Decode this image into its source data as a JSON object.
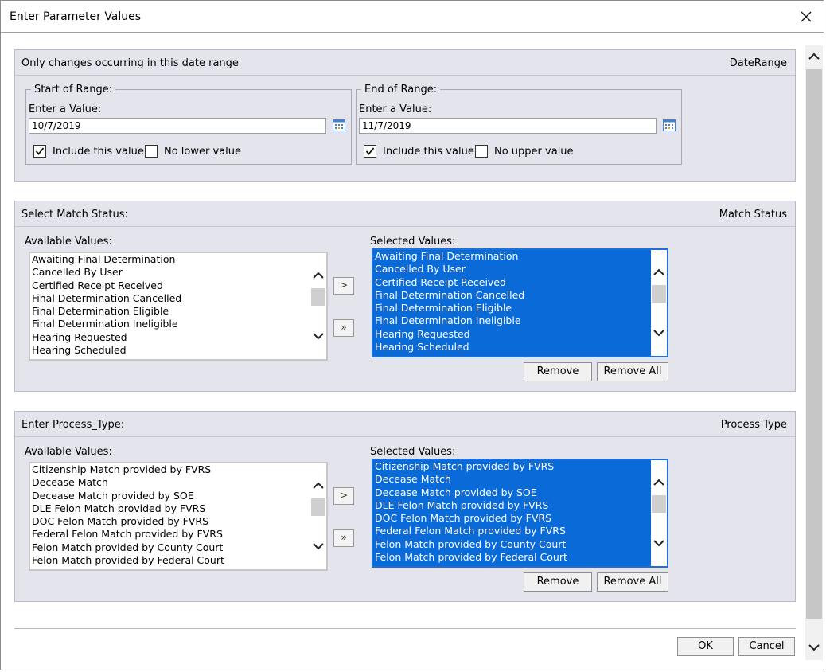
{
  "dialog": {
    "title": "Enter Parameter Values"
  },
  "date_range": {
    "prompt": "Only changes occurring in this date range",
    "name": "DateRange",
    "start": {
      "legend": "Start of Range:",
      "label": "Enter a Value:",
      "value": "10/7/2019",
      "include_label": "Include this value",
      "include_checked": true,
      "limit_label": "No lower value",
      "limit_checked": false
    },
    "end": {
      "legend": "End of Range:",
      "label": "Enter a Value:",
      "value": "11/7/2019",
      "include_label": "Include this value",
      "include_checked": true,
      "limit_label": "No upper value",
      "limit_checked": false
    }
  },
  "match_status": {
    "prompt": "Select Match Status:",
    "name": "Match Status",
    "available_label": "Available Values:",
    "selected_label": "Selected Values:",
    "available": [
      "Awaiting Final Determination",
      "Cancelled By User",
      "Certified Receipt Received",
      "Final Determination Cancelled",
      "Final Determination Eligible",
      "Final Determination Ineligible",
      "Hearing Requested",
      "Hearing Scheduled"
    ],
    "selected": [
      "Awaiting Final Determination",
      "Cancelled By User",
      "Certified Receipt Received",
      "Final Determination Cancelled",
      "Final Determination Eligible",
      "Final Determination Ineligible",
      "Hearing Requested",
      "Hearing Scheduled"
    ],
    "add_label": ">",
    "add_all_label": "»",
    "remove_label": "Remove",
    "remove_all_label": "Remove All"
  },
  "process_type": {
    "prompt": "Enter Process_Type:",
    "name": "Process Type",
    "available_label": "Available Values:",
    "selected_label": "Selected Values:",
    "available": [
      "Citizenship Match provided by FVRS",
      "Decease Match",
      "Decease Match provided by SOE",
      "DLE Felon Match provided by FVRS",
      "DOC Felon Match provided by FVRS",
      "Federal Felon Match provided by FVRS",
      "Felon Match provided by County Court",
      "Felon Match provided by Federal Court"
    ],
    "selected": [
      "Citizenship Match provided by FVRS",
      "Decease Match",
      "Decease Match provided by SOE",
      "DLE Felon Match provided by FVRS",
      "DOC Felon Match provided by FVRS",
      "Federal Felon Match provided by FVRS",
      "Felon Match provided by County Court",
      "Felon Match provided by Federal Court"
    ],
    "add_label": ">",
    "add_all_label": "»",
    "remove_label": "Remove",
    "remove_all_label": "Remove All"
  },
  "footer": {
    "ok_label": "OK",
    "cancel_label": "Cancel"
  },
  "icons": {
    "close": "close-icon",
    "calendar": "calendar-icon",
    "scroll_up": "chevron-up-icon",
    "scroll_down": "chevron-down-icon",
    "checkmark": "checkmark-icon"
  },
  "colors": {
    "panel_bg": "#e4e4ed",
    "selection_bg": "#0a6ad8",
    "selection_text": "#ffffff"
  }
}
